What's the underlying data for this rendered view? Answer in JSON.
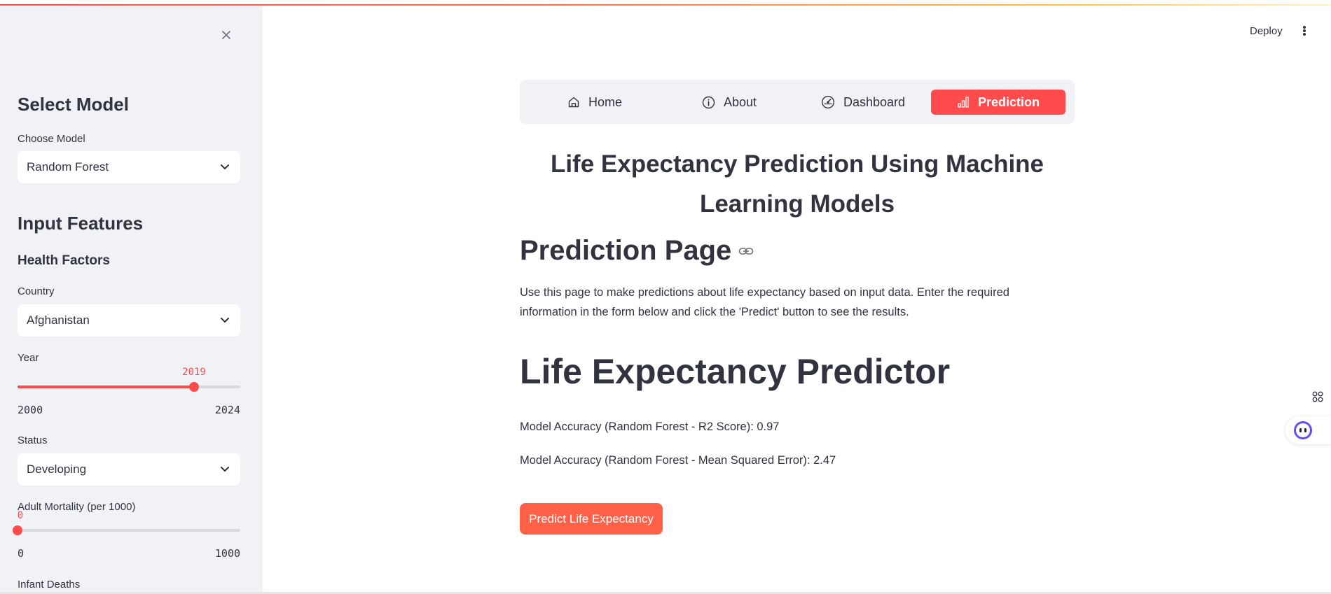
{
  "sidebar": {
    "select_model_heading": "Select Model",
    "choose_model_label": "Choose Model",
    "choose_model_value": "Random Forest",
    "input_features_heading": "Input Features",
    "health_factors_heading": "Health Factors",
    "country_label": "Country",
    "country_value": "Afghanistan",
    "year": {
      "label": "Year",
      "value": "2019",
      "min": "2000",
      "max": "2024",
      "fraction": 0.792
    },
    "status_label": "Status",
    "status_value": "Developing",
    "adult_mortality": {
      "label": "Adult Mortality (per 1000)",
      "value": "0",
      "min": "0",
      "max": "1000",
      "fraction": 0
    },
    "infant_deaths_label": "Infant Deaths"
  },
  "header": {
    "deploy_label": "Deploy"
  },
  "nav": {
    "items": [
      {
        "label": "Home",
        "icon": "house-icon"
      },
      {
        "label": "About",
        "icon": "info-circle-icon"
      },
      {
        "label": "Dashboard",
        "icon": "speedometer-icon"
      },
      {
        "label": "Prediction",
        "icon": "bar-chart-icon",
        "active": true
      }
    ]
  },
  "main": {
    "title": "Life Expectancy Prediction Using Machine Learning Models",
    "page_heading": "Prediction Page",
    "description": "Use this page to make predictions about life expectancy based on input data. Enter the required information in the form below and click the 'Predict' button to see the results.",
    "predictor_heading": "Life Expectancy Predictor",
    "metric_r2": "Model Accuracy (Random Forest - R2 Score): 0.97",
    "metric_mse": "Model Accuracy (Random Forest - Mean Squared Error): 2.47",
    "predict_button": "Predict Life Expectancy"
  },
  "colors": {
    "accent": "#ff4b4b",
    "button": "#ff6148",
    "sidebar_bg": "#f0f2f6",
    "text": "#31333f"
  }
}
